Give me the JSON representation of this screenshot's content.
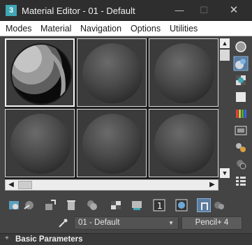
{
  "window": {
    "app_icon": "3",
    "title": "Material Editor - 01 - Default",
    "minimize_glyph": "—",
    "maximize_glyph": "☐",
    "close_glyph": "✕"
  },
  "menu": {
    "items": [
      "Modes",
      "Material",
      "Navigation",
      "Options",
      "Utilities"
    ]
  },
  "sample_slots": {
    "count": 6,
    "active_index": 0
  },
  "scroll": {
    "up_glyph": "▲",
    "down_glyph": "▼",
    "left_glyph": "◀",
    "right_glyph": "▶"
  },
  "side_tools": [
    "sample-type-icon",
    "backlight-icon",
    "background-icon",
    "tiling-icon",
    "video-color-check-icon",
    "make-preview-icon",
    "options-icon",
    "select-by-material-icon",
    "material-map-navigator-icon"
  ],
  "bottom_tools": [
    "get-material-icon",
    "put-to-scene-icon",
    "assign-to-selection-icon",
    "reset-map-icon",
    "make-unique-icon",
    "put-to-library-icon",
    "material-id-channel-icon",
    "show-shaded-material-icon",
    "show-end-result-icon",
    "go-to-parent-icon",
    "go-forward-to-sibling-icon"
  ],
  "material": {
    "name": "01 - Default",
    "type_button": "Pencil+ 4"
  },
  "rollout": {
    "toggle": "+",
    "label": "Basic Parameters"
  },
  "colors": {
    "accent": "#3fa7b5",
    "panel": "#444444",
    "slot_bg": "#3b3b3b"
  }
}
